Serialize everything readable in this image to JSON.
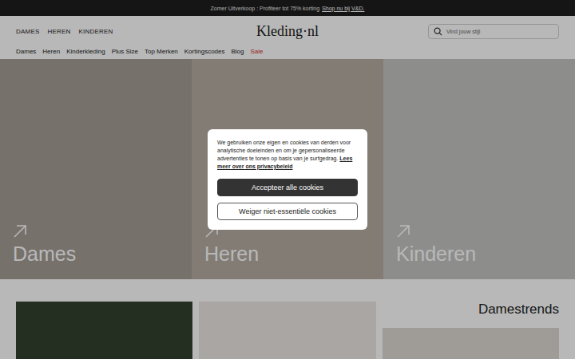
{
  "announcement": {
    "text": "Zomer Uitverkoop : Profiteer tot 75% korting",
    "link": "Shop nu bij V&D."
  },
  "header": {
    "nav": [
      "DAMES",
      "HEREN",
      "KINDEREN"
    ],
    "logo": "Kleding·nl",
    "search": {
      "placeholder": "Vind jouw stijl"
    }
  },
  "subnav": [
    {
      "label": "Dames",
      "highlighted": false
    },
    {
      "label": "Heren",
      "highlighted": false
    },
    {
      "label": "Kinderkleding",
      "highlighted": false
    },
    {
      "label": "Plus Size",
      "highlighted": false
    },
    {
      "label": "Top Merken",
      "highlighted": false
    },
    {
      "label": "Kortingscodes",
      "highlighted": false
    },
    {
      "label": "Blog",
      "highlighted": false
    },
    {
      "label": "Sale",
      "highlighted": true
    }
  ],
  "hero": [
    {
      "label": "Dames"
    },
    {
      "label": "Heren"
    },
    {
      "label": "Kinderen"
    }
  ],
  "trends": {
    "title": "Damestrends"
  },
  "cookie_dialog": {
    "text": "We gebruiken onze eigen en cookies van derden voor analytische doeleinden en om je gepersonaliseerde advertenties te tonen op basis van je surfgedrag.",
    "link": "Lees meer over ons privacybeleid",
    "buttons": [
      {
        "label": "Accepteer alle cookies",
        "kind": "primary"
      },
      {
        "label": "Weiger niet-essentiële cookies",
        "kind": "secondary"
      }
    ]
  }
}
